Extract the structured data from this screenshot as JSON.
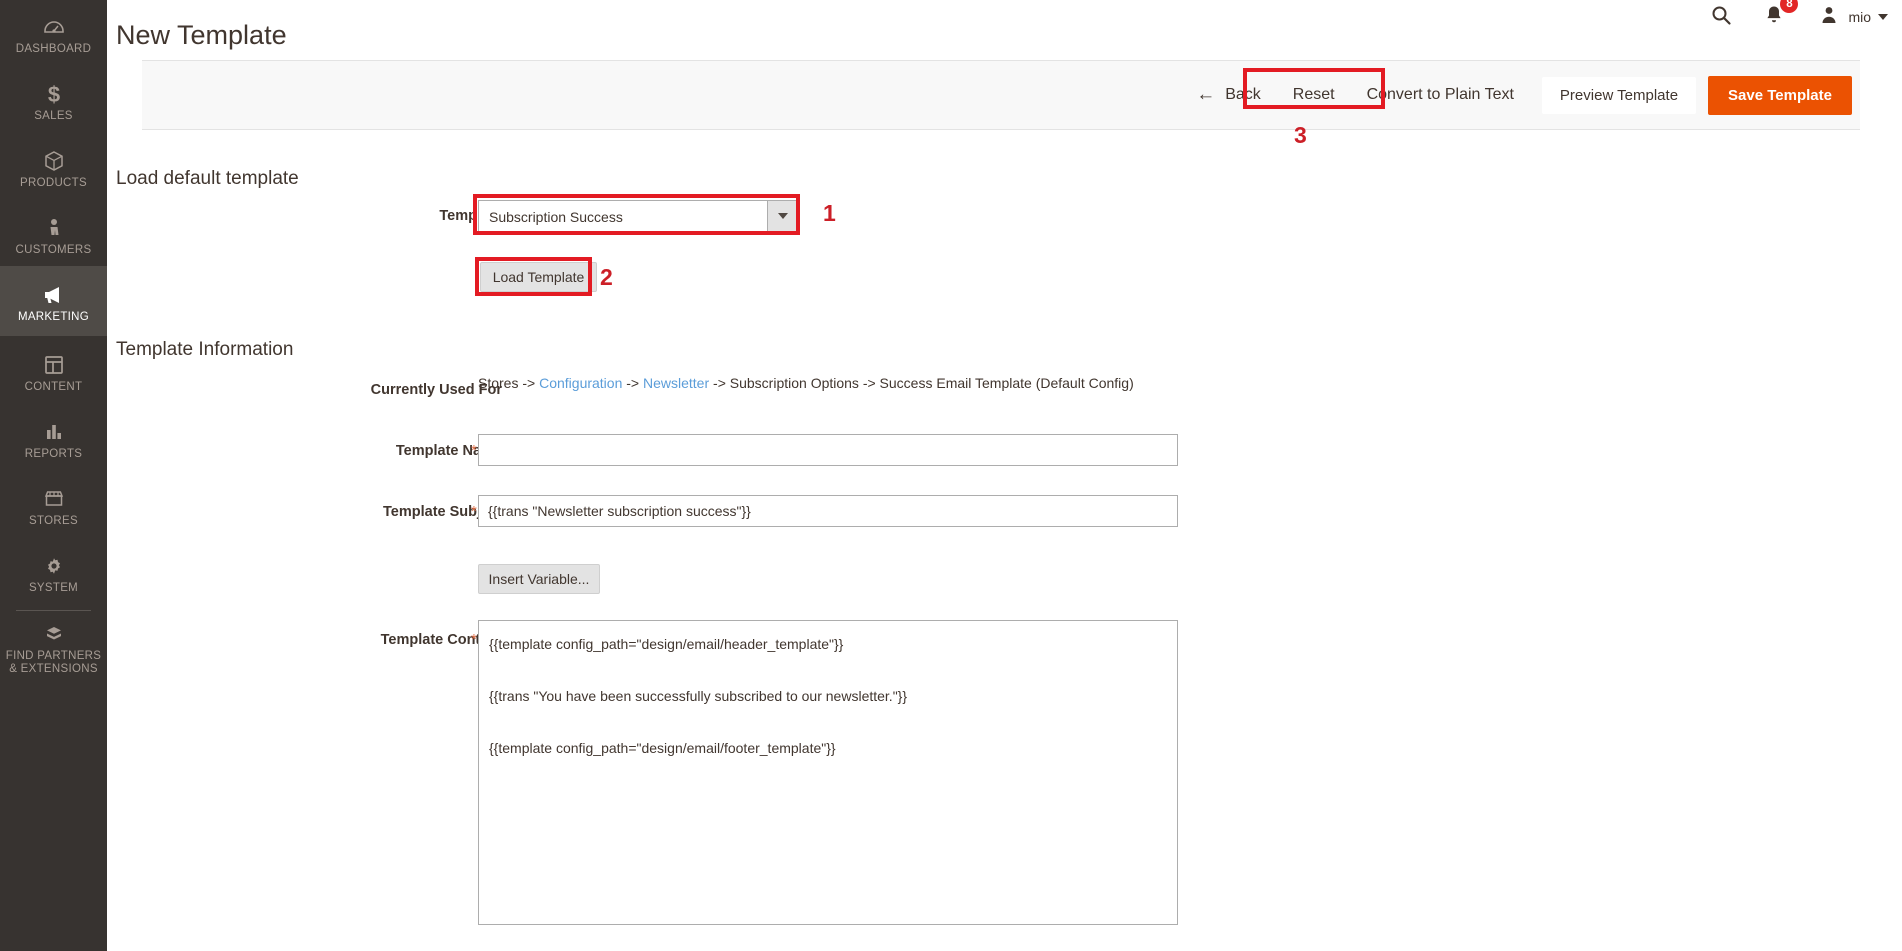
{
  "sidebar": {
    "items": [
      {
        "label": "DASHBOARD",
        "icon": "dashboard-icon",
        "active": false
      },
      {
        "label": "SALES",
        "icon": "dollar-icon",
        "active": false
      },
      {
        "label": "PRODUCTS",
        "icon": "box-icon",
        "active": false
      },
      {
        "label": "CUSTOMERS",
        "icon": "person-icon",
        "active": false
      },
      {
        "label": "MARKETING",
        "icon": "megaphone-icon",
        "active": true
      },
      {
        "label": "CONTENT",
        "icon": "layout-icon",
        "active": false
      },
      {
        "label": "REPORTS",
        "icon": "bar-chart-icon",
        "active": false
      },
      {
        "label": "STORES",
        "icon": "storefront-icon",
        "active": false
      },
      {
        "label": "SYSTEM",
        "icon": "gear-icon",
        "active": false
      },
      {
        "label": "FIND PARTNERS\n& EXTENSIONS",
        "icon": "extensions-icon",
        "active": false
      }
    ]
  },
  "header": {
    "title": "New Template",
    "search_icon": "search-icon",
    "notifications_icon": "bell-icon",
    "notifications_count": "8",
    "avatar_icon": "user-avatar-icon",
    "user_name": "mio",
    "caret_icon": "chevron-down-icon"
  },
  "toolbar": {
    "back_label": "Back",
    "back_icon": "arrow-left-icon",
    "reset_label": "Reset",
    "convert_label": "Convert to Plain Text",
    "preview_label": "Preview Template",
    "save_label": "Save Template"
  },
  "annotations": [
    {
      "number": "1",
      "target": "template-select"
    },
    {
      "number": "2",
      "target": "load-template-button"
    },
    {
      "number": "3",
      "target": "preview-template-button"
    }
  ],
  "load_default": {
    "section_title": "Load default template",
    "template_label": "Template",
    "template_value": "Subscription Success",
    "load_button_label": "Load Template"
  },
  "template_info": {
    "section_title": "Template Information",
    "used_for_label": "Currently Used For",
    "used_for_prefix": "Stores -> ",
    "used_for_link1": "Configuration",
    "used_for_sep1": " -> ",
    "used_for_link2": "Newsletter",
    "used_for_suffix": " -> Subscription Options -> Success Email Template  (Default Config)",
    "name_label": "Template Name",
    "name_value": "",
    "name_placeholder": "",
    "subject_label": "Template Subject",
    "subject_value": "{{trans \"Newsletter subscription success\"}}",
    "insert_variable_label": "Insert Variable...",
    "content_label": "Template Content",
    "content_value": "{{template config_path=\"design/email/header_template\"}}\n\n{{trans \"You have been successfully subscribed to our newsletter.\"}}\n\n{{template config_path=\"design/email/footer_template\"}}",
    "required_marker": "*"
  },
  "colors": {
    "sidebar_bg": "#373330",
    "sidebar_active": "#4f4b47",
    "accent_orange": "#eb5202",
    "annotation_red": "#e31b23",
    "link_blue": "#5b9dd9",
    "badge_red": "#e22626"
  }
}
